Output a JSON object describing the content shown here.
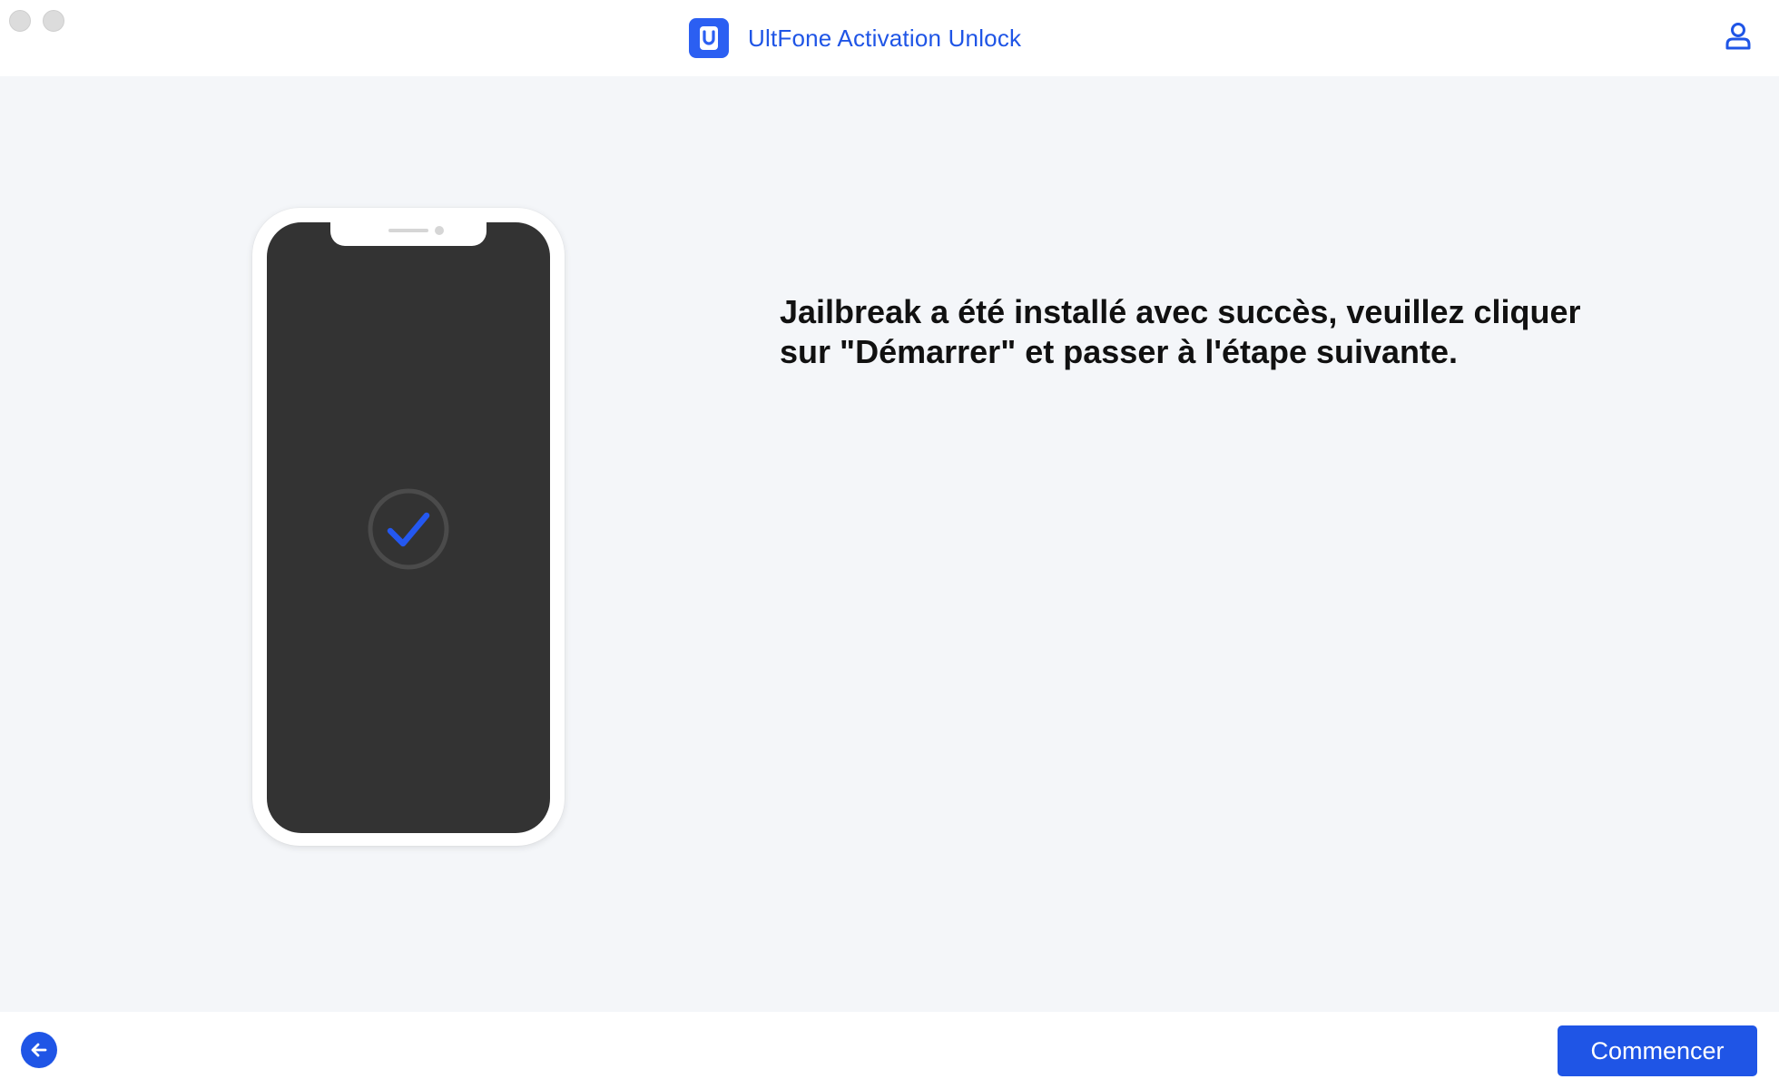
{
  "window": {
    "controls": [
      "close",
      "minimize"
    ]
  },
  "header": {
    "app_title": "UltFone Activation Unlock",
    "logo_icon": "unlock-logo-icon",
    "account_icon": "user-account-icon"
  },
  "main": {
    "illustration": {
      "device": "phone",
      "status_icon": "checkmark-icon"
    },
    "message": "Jailbreak a été installé avec succès, veuillez cliquer sur \"Démarrer\" et passer à l'étape suivante."
  },
  "footer": {
    "back_icon": "arrow-left-icon",
    "start_label": "Commencer"
  },
  "colors": {
    "accent": "#1f55e6",
    "logo_bg": "#2b5ff2",
    "main_bg": "#f4f6f9",
    "phone_screen": "#333333",
    "message_text": "#111111"
  }
}
